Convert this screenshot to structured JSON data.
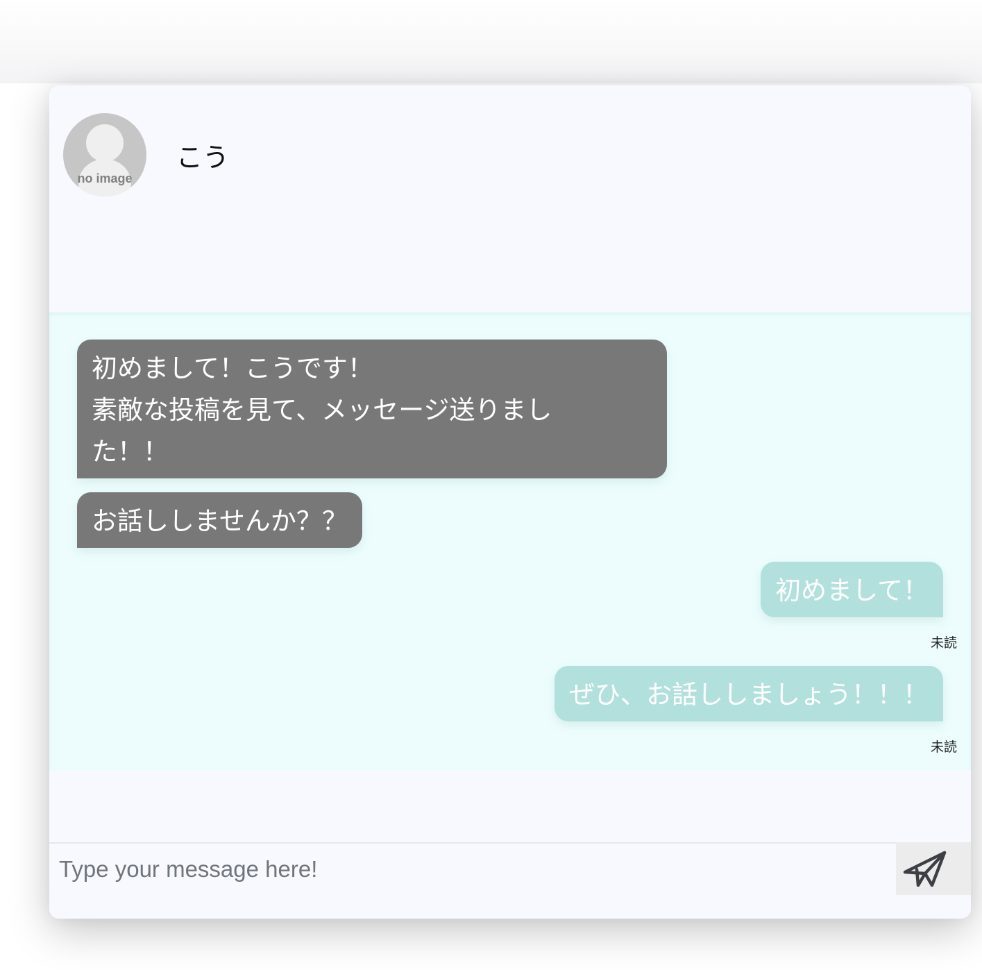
{
  "chat_header": {
    "avatar_label": "no image",
    "username": "こう"
  },
  "messages": [
    {
      "side": "received",
      "lines": [
        "初めまして！こうです！",
        "素敵な投稿を見て、メッセージ送りまし",
        "た！！"
      ]
    },
    {
      "side": "received",
      "text": "お話ししませんか？？"
    },
    {
      "side": "sent",
      "text": "初めまして！",
      "status": "未読"
    },
    {
      "side": "sent",
      "text": "ぜひ、お話ししましょう！！！",
      "status": "未読"
    }
  ],
  "composer": {
    "placeholder": "Type your message here!",
    "send_icon": "paper-plane-icon"
  },
  "colors": {
    "received_bubble": "#787878",
    "sent_bubble": "#b2e1dd",
    "messages_background": "#edfdfd",
    "card_background": "#f8f9fe"
  }
}
